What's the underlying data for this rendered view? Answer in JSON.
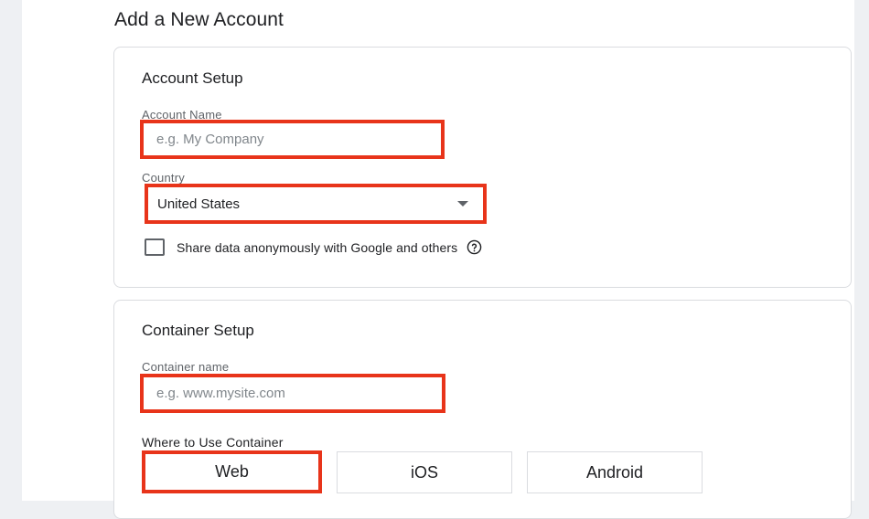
{
  "page": {
    "title": "Add a New Account"
  },
  "account_setup": {
    "title": "Account Setup",
    "account_name": {
      "label": "Account Name",
      "placeholder": "e.g. My Company",
      "value": ""
    },
    "country": {
      "label": "Country",
      "value": "United States"
    },
    "share_data": {
      "label": "Share data anonymously with Google and others",
      "checked": false
    }
  },
  "container_setup": {
    "title": "Container Setup",
    "container_name": {
      "label": "Container name",
      "placeholder": "e.g. www.mysite.com",
      "value": ""
    },
    "where_to_use": {
      "label": "Where to Use Container",
      "options": [
        "Web",
        "iOS",
        "Android"
      ],
      "selected": "Web"
    }
  },
  "colors": {
    "highlight": "#e8341a",
    "border": "#dadce0",
    "text": "#202124",
    "muted": "#5f6368"
  },
  "icons": {
    "dropdown": "caret-down-icon",
    "help": "help-circle-icon",
    "checkbox": "checkbox-unchecked-icon"
  }
}
